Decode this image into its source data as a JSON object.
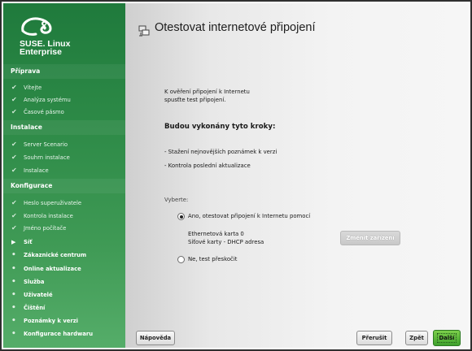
{
  "sidebar": {
    "brand_line1": "SUSE. Linux",
    "brand_line2": "Enterprise",
    "sections": [
      {
        "title": "Příprava",
        "items": [
          {
            "label": "Vítejte",
            "state": "done"
          },
          {
            "label": "Analýza systému",
            "state": "done"
          },
          {
            "label": "Časové pásmo",
            "state": "done"
          }
        ]
      },
      {
        "title": "Instalace",
        "items": [
          {
            "label": "Server Scenario",
            "state": "done"
          },
          {
            "label": "Souhrn instalace",
            "state": "done"
          },
          {
            "label": "Instalace",
            "state": "done"
          }
        ]
      },
      {
        "title": "Konfigurace",
        "items": [
          {
            "label": "Heslo superuživatele",
            "state": "done"
          },
          {
            "label": "Kontrola instalace",
            "state": "done"
          },
          {
            "label": "Jméno počítače",
            "state": "done"
          },
          {
            "label": "Síť",
            "state": "current"
          },
          {
            "label": "Zákaznické centrum",
            "state": "pending"
          },
          {
            "label": "Online aktualizace",
            "state": "pending"
          },
          {
            "label": "Služba",
            "state": "pending"
          },
          {
            "label": "Uživatelé",
            "state": "pending"
          },
          {
            "label": "Čištění",
            "state": "pending"
          },
          {
            "label": "Poznámky k verzi",
            "state": "pending"
          },
          {
            "label": "Konfigurace hardwaru",
            "state": "pending"
          }
        ]
      }
    ]
  },
  "main": {
    "title": "Otestovat internetové připojení",
    "intro_line1": "K ověření připojení k Internetu",
    "intro_line2": "spusťte test připojení.",
    "steps_heading": "Budou vykonány tyto kroky:",
    "step1": "- Stažení nejnovějších poznámek k verzi",
    "step2": "- Kontrola poslední aktualizace",
    "choose_label": "Vyberte:",
    "option_yes": "Ano, otestovat připojení k Internetu pomocí",
    "device_line1": "Ethernetová karta 0",
    "device_line2": "Síťové karty - DHCP adresa",
    "change_device_button": "Změnit zařízení",
    "option_no": "Ne, test přeskočit"
  },
  "buttons": {
    "help": "Nápověda",
    "abort": "Přerušit",
    "back": "Zpět",
    "next": "Další"
  },
  "icons": {
    "done": "checkmark-icon",
    "current": "arrow-right-icon",
    "pending": "bullet-icon",
    "title": "network-icon"
  },
  "colors": {
    "sidebar_top": "#1f7a3c",
    "sidebar_bottom": "#55ad69",
    "next_button": "#3fa12d"
  }
}
